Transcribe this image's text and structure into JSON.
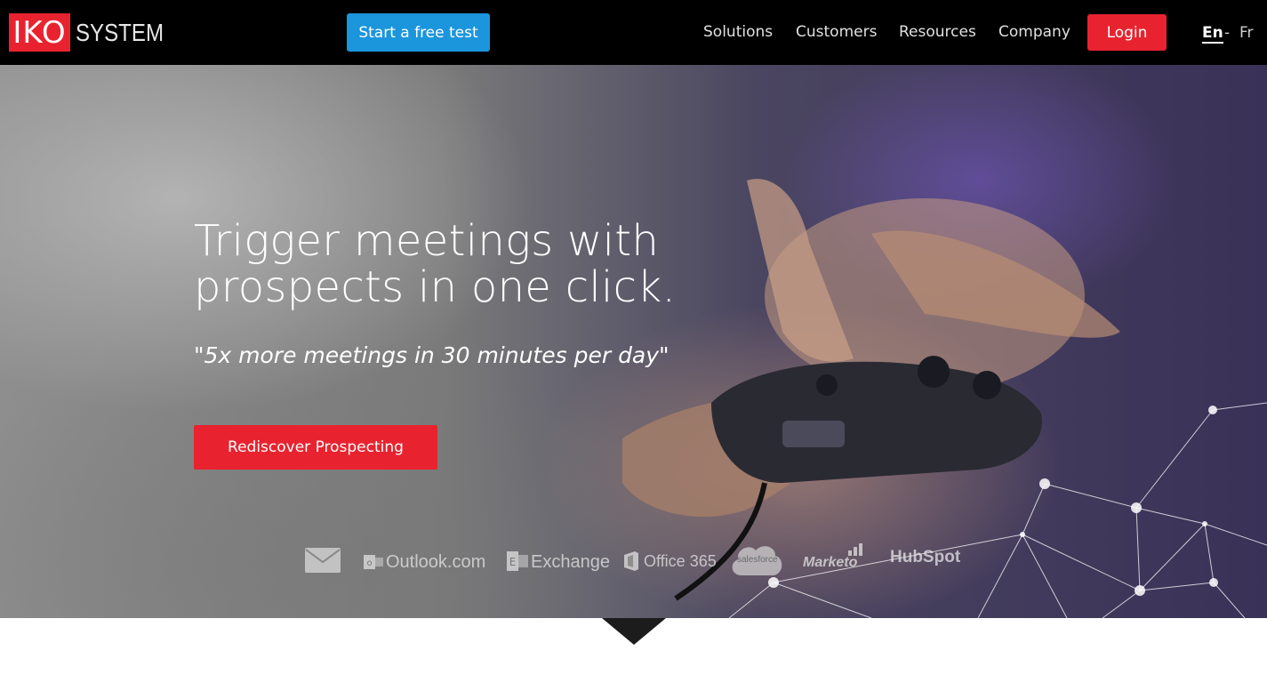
{
  "header": {
    "logo_mark": "IKO",
    "logo_text": "SYSTEM",
    "cta_label": "Start a free test",
    "nav": [
      "Solutions",
      "Customers",
      "Resources",
      "Company"
    ],
    "login_label": "Login",
    "lang_en": "En",
    "lang_sep": "-",
    "lang_fr": "Fr"
  },
  "hero": {
    "title_line1": "Trigger meetings with",
    "title_line2": "prospects in one click.",
    "quote": "\"5x more meetings in 30 minutes per day\"",
    "cta_label": "Rediscover Prospecting"
  },
  "integrations": {
    "items": [
      {
        "name": "mail-icon",
        "label": ""
      },
      {
        "name": "outlook-logo",
        "label": "Outlook.com"
      },
      {
        "name": "exchange-logo",
        "label": "Exchange"
      },
      {
        "name": "office365-logo",
        "label": "Office 365"
      },
      {
        "name": "salesforce-logo",
        "label": "salesforce"
      },
      {
        "name": "marketo-logo",
        "label": "Marketo"
      },
      {
        "name": "hubspot-logo",
        "label": "HubSpot"
      }
    ]
  },
  "colors": {
    "brand_red": "#e8232f",
    "cta_blue": "#1b95dc",
    "header_bg": "#000000"
  }
}
